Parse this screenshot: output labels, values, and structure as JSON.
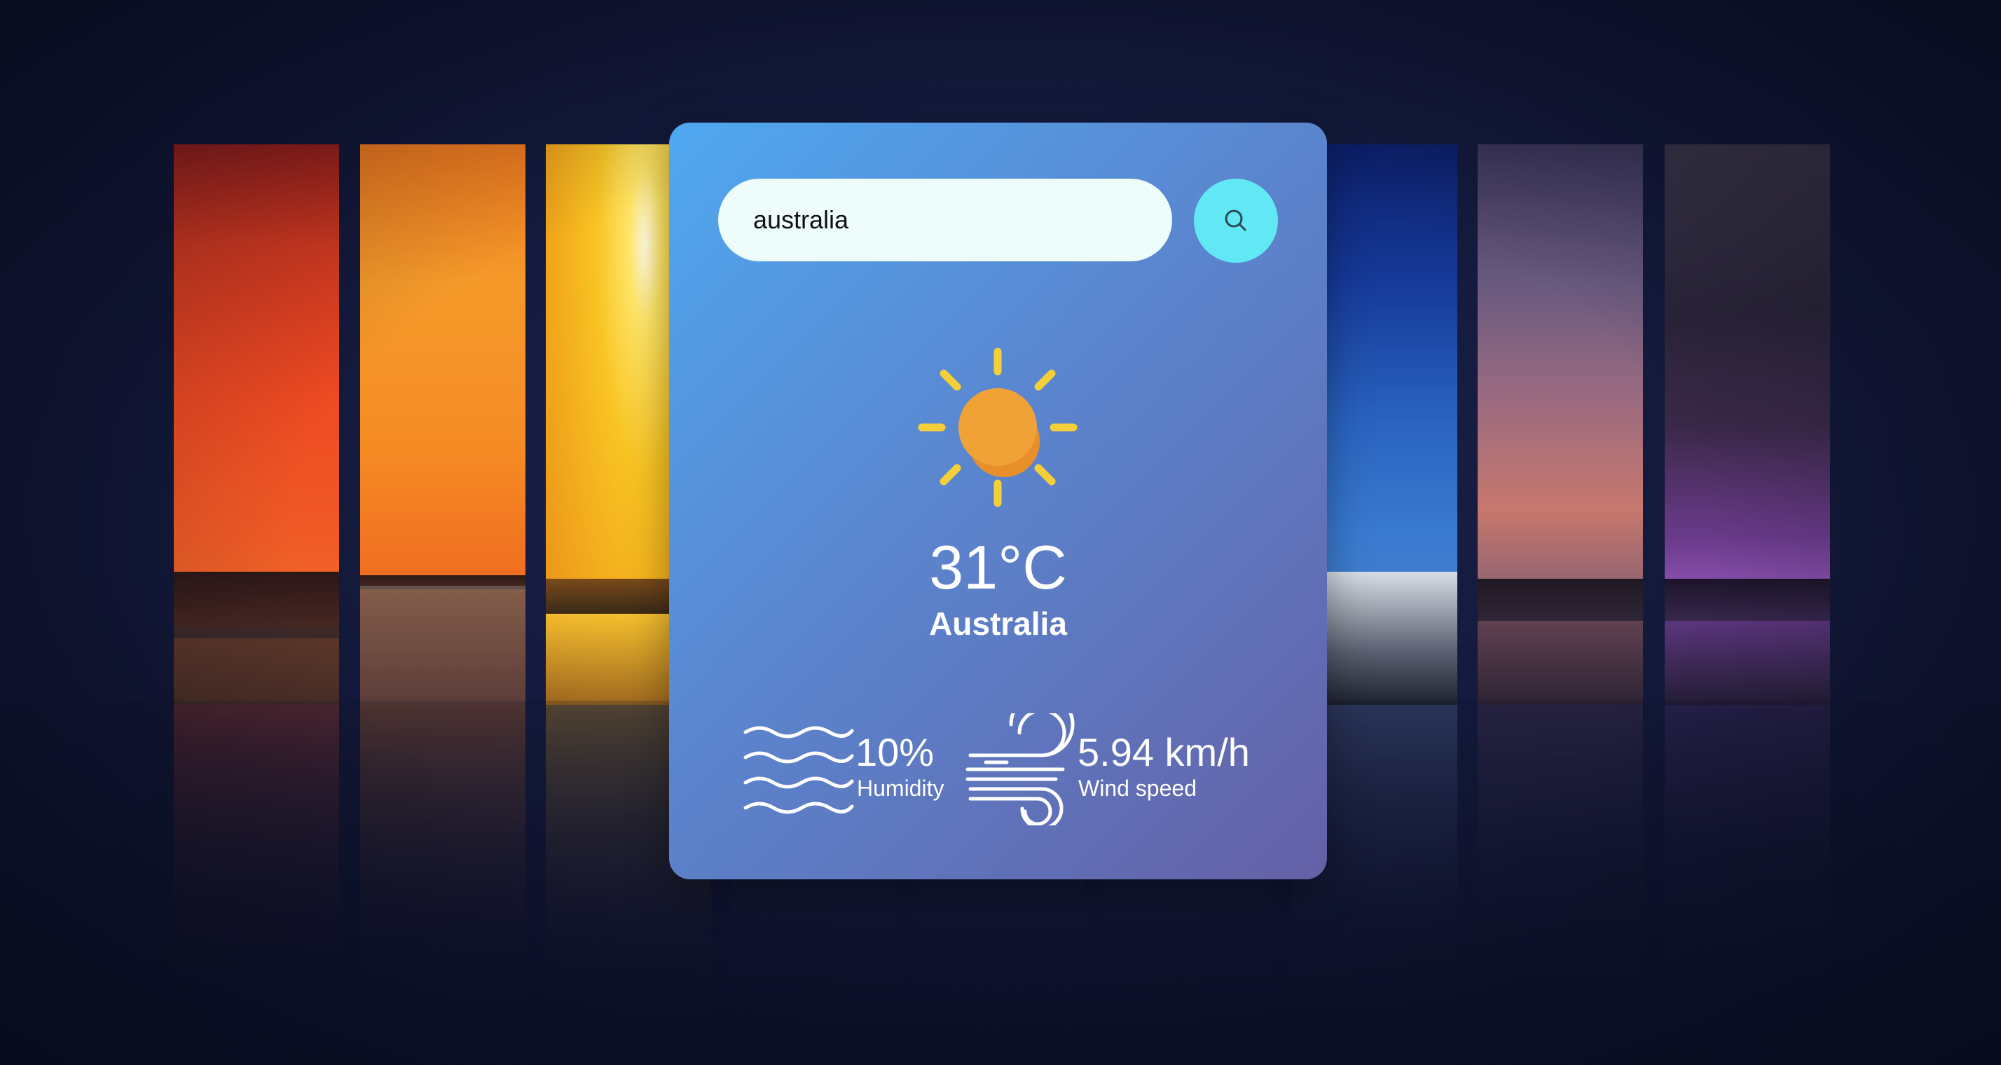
{
  "search": {
    "value": "australia",
    "button_icon": "search-icon"
  },
  "weather": {
    "icon": "sun-icon",
    "temperature": "31°C",
    "city": "Australia"
  },
  "details": {
    "humidity": {
      "icon": "humidity-waves-icon",
      "value": "10%",
      "label": "Humidity"
    },
    "wind": {
      "icon": "wind-icon",
      "value": "5.94 km/h",
      "label": "Wind speed"
    }
  },
  "colors": {
    "card_gradient_start": "#4fa8f0",
    "card_gradient_end": "#6560a6",
    "search_bg": "#eefcfb",
    "search_button_bg": "#62e8f4",
    "sun": "#f5b041",
    "sun_rays": "#f4d03f",
    "text": "#ffffff",
    "page_bg": "#111634"
  }
}
